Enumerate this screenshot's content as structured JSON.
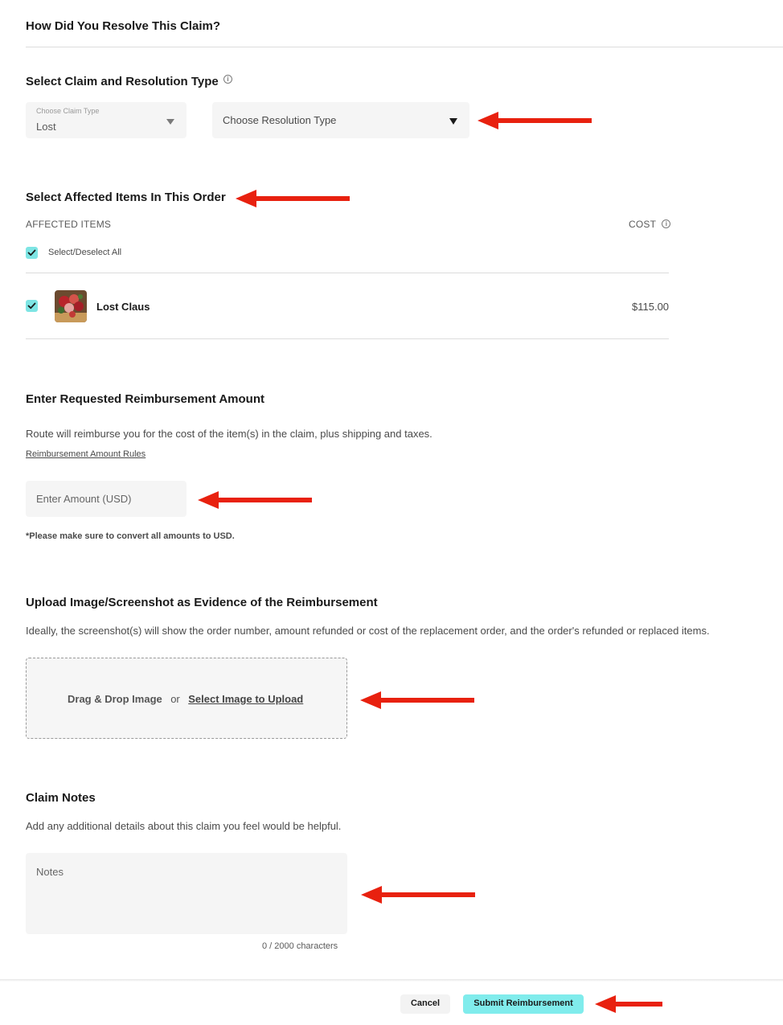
{
  "page": {
    "title": "How Did You Resolve This Claim?"
  },
  "claim_type_section": {
    "heading": "Select Claim and Resolution Type",
    "info_icon": "info-icon",
    "claim_type": {
      "label": "Choose Claim Type",
      "value": "Lost"
    },
    "resolution_type": {
      "placeholder": "Choose Resolution Type"
    }
  },
  "affected_items_section": {
    "heading": "Select Affected Items In This Order",
    "columns": {
      "items": "AFFECTED ITEMS",
      "cost": "COST"
    },
    "select_all_label": "Select/Deselect All",
    "items": [
      {
        "name": "Lost Claus",
        "cost": "$115.00",
        "checked": true
      }
    ]
  },
  "reimbursement_section": {
    "heading": "Enter Requested Reimbursement Amount",
    "description": "Route will reimburse you for the cost of the item(s) in the claim, plus shipping and taxes.",
    "rules_link": "Reimbursement Amount Rules",
    "amount_placeholder": "Enter Amount (USD)",
    "note": "*Please make sure to convert all amounts to USD."
  },
  "evidence_section": {
    "heading": "Upload Image/Screenshot as Evidence of the Reimbursement",
    "description": "Ideally, the screenshot(s) will show the order number, amount refunded or cost of the replacement order, and the order's refunded or replaced items.",
    "dropzone": {
      "drag_text": "Drag & Drop Image",
      "or_text": "or",
      "select_link": "Select Image to Upload"
    }
  },
  "notes_section": {
    "heading": "Claim Notes",
    "description": "Add any additional details about this claim you feel would be helpful.",
    "placeholder": "Notes",
    "char_count": "0 / 2000 characters"
  },
  "footer": {
    "cancel_label": "Cancel",
    "submit_label": "Submit Reimbursement"
  },
  "colors": {
    "accent": "#80ecec",
    "checkbox": "#7ee5e4",
    "annotation_arrow": "#e8210f"
  }
}
